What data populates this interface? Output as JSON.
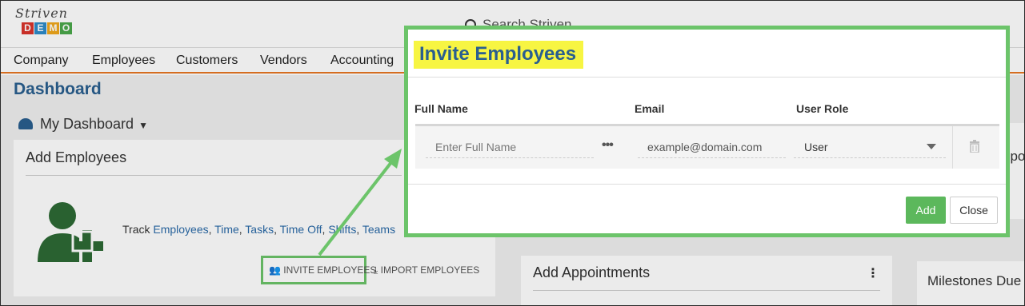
{
  "brand": {
    "script_name": "Striven",
    "demo_letters": [
      "D",
      "E",
      "M",
      "O"
    ],
    "demo_colors": [
      "#d9342b",
      "#2e8bc9",
      "#f0a81c",
      "#4aa84a"
    ]
  },
  "search": {
    "label": "Search Striven"
  },
  "nav": {
    "items": [
      "Company",
      "Employees",
      "Customers",
      "Vendors",
      "Accounting"
    ]
  },
  "page": {
    "title": "Dashboard",
    "dashboard_selector": "My Dashboard"
  },
  "add_employees_panel": {
    "title": "Add Employees",
    "track_prefix": "Track",
    "links": [
      "Employees",
      "Time",
      "Tasks",
      "Time Off",
      "Shifts",
      "Teams"
    ],
    "separator": ",",
    "invite_label": "INVITE EMPLOYEES",
    "import_label": "IMPORT EMPLOYEES",
    "icon_color": "#2d6a35"
  },
  "appointments_panel": {
    "title": "Add Appointments",
    "menu_glyph": "⋮"
  },
  "milestones_panel": {
    "title": "Milestones Due"
  },
  "right_top_panel": {
    "fragment": "ppo"
  },
  "modal": {
    "title": "Invite Employees",
    "columns": {
      "full_name": "Full Name",
      "email": "Email",
      "user_role": "User Role"
    },
    "row": {
      "full_name_placeholder": "Enter Full Name",
      "email_placeholder": "example@domain.com",
      "role_value": "User",
      "more_glyph": "•••"
    },
    "add_label": "Add",
    "close_label": "Close",
    "highlight_color": "#f7f542",
    "accent_green": "#6cc46a"
  }
}
